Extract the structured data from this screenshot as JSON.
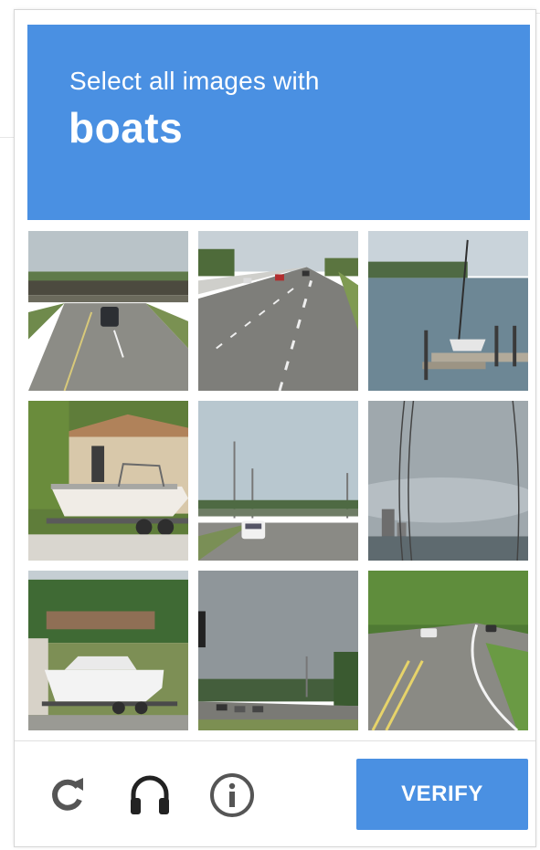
{
  "challenge": {
    "instruction": "Select all images with",
    "target": "boats"
  },
  "tiles": [
    {
      "row": 1,
      "col": 1,
      "depicts": "highway-overpass-car"
    },
    {
      "row": 1,
      "col": 2,
      "depicts": "highway-traffic"
    },
    {
      "row": 1,
      "col": 3,
      "depicts": "sailboat-at-dock"
    },
    {
      "row": 2,
      "col": 1,
      "depicts": "boat-on-trailer-house"
    },
    {
      "row": 2,
      "col": 2,
      "depicts": "highway-overpass-van"
    },
    {
      "row": 2,
      "col": 3,
      "depicts": "sky-city-wires"
    },
    {
      "row": 3,
      "col": 1,
      "depicts": "boat-on-trailer-trees"
    },
    {
      "row": 3,
      "col": 2,
      "depicts": "road-cloudy-traffic-light"
    },
    {
      "row": 3,
      "col": 3,
      "depicts": "curved-road-trees"
    }
  ],
  "footer": {
    "reload_icon": "reload-icon",
    "audio_icon": "headphones-icon",
    "info_icon": "info-icon",
    "verify_label": "VERIFY"
  },
  "colors": {
    "accent": "#4a90e2",
    "icon": "#555555"
  }
}
